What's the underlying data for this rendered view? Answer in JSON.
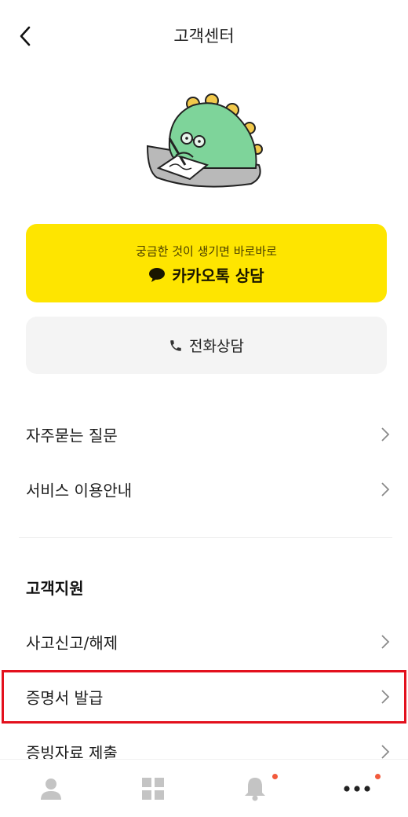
{
  "header": {
    "title": "고객센터"
  },
  "kakao": {
    "subtitle": "궁금한 것이 생기면 바로바로",
    "label": "카카오톡 상담"
  },
  "phone": {
    "label": "전화상담"
  },
  "menu": {
    "faq": "자주묻는 질문",
    "guide": "서비스 이용안내"
  },
  "support": {
    "title": "고객지원",
    "items": [
      "사고신고/해제",
      "증명서 발급",
      "증빙자료 제출"
    ]
  },
  "tabbar": {
    "items": [
      "profile-icon",
      "grid-icon",
      "bell-icon",
      "more-icon"
    ],
    "badge_color": "#f25a3c"
  },
  "colors": {
    "kakao_yellow": "#fee500",
    "highlight_red": "#e3101d",
    "mascot_green": "#7ed49a"
  }
}
